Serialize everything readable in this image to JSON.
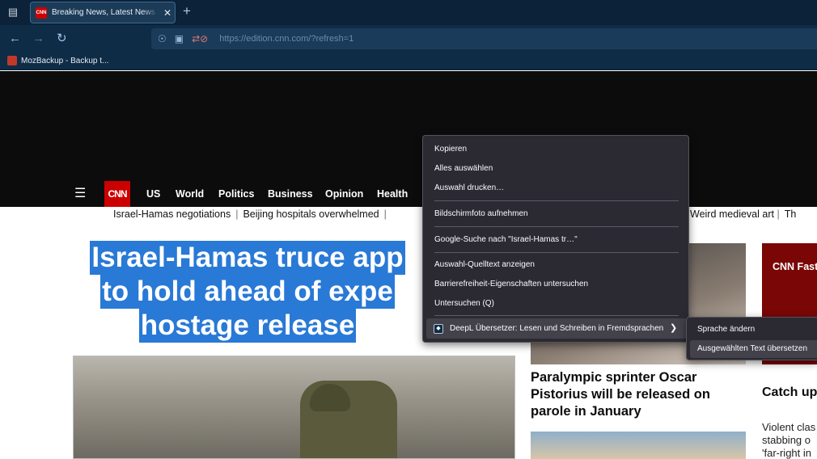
{
  "browser": {
    "tab": {
      "title": "Breaking News, Latest News and",
      "favicon_text": "CNN"
    },
    "url": "https://edition.cnn.com/?refresh=1",
    "bookmark": "MozBackup - Backup t..."
  },
  "cnn_nav": {
    "logo": "CNN",
    "links": [
      "US",
      "World",
      "Politics",
      "Business",
      "Opinion",
      "Health"
    ]
  },
  "trending": {
    "left": [
      "Israel-Hamas negotiations",
      "Beijing hospitals overwhelmed"
    ],
    "right": [
      "Weird medieval art",
      "Th"
    ]
  },
  "headline_lines": [
    "Israel-Hamas truce app",
    "to hold ahead of expe",
    "hostage release"
  ],
  "side_story": {
    "headline": "Paralympic sprinter Oscar Pistorius will be released on parole in January"
  },
  "right_column": {
    "promo": "CNN Fast",
    "section": "Catch up",
    "teaser_lines": [
      "Violent clas",
      "stabbing o",
      "'far-right in"
    ]
  },
  "context_menu": {
    "items": [
      "Kopieren",
      "Alles auswählen",
      "Auswahl drucken…",
      "Bildschirmfoto aufnehmen",
      "Google-Suche nach \"Israel-Hamas tr…\"",
      "Auswahl-Quelltext anzeigen",
      "Barrierefreiheit-Eigenschaften untersuchen",
      "Untersuchen (Q)",
      "DeepL Übersetzer: Lesen und Schreiben in Fremdsprachen"
    ]
  },
  "submenu": {
    "items": [
      "Sprache ändern",
      "Ausgewählten Text übersetzen"
    ]
  },
  "colors": {
    "cnn_red": "#cc0000",
    "selection_blue": "#2979d6",
    "menu_bg": "#2b2a33"
  }
}
